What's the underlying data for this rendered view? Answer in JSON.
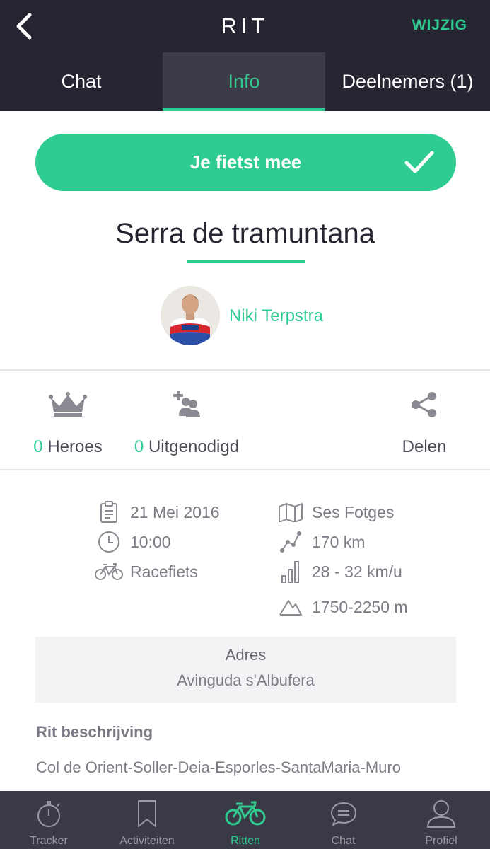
{
  "header": {
    "title": "RIT",
    "edit_label": "WIJZIG"
  },
  "tabs": [
    {
      "label": "Chat"
    },
    {
      "label": "Info",
      "active": true
    },
    {
      "label": "Deelnemers (1)"
    }
  ],
  "join_button": {
    "label": "Je fietst mee"
  },
  "ride": {
    "title": "Serra de tramuntana",
    "host": "Niki Terpstra"
  },
  "stats": {
    "heroes_count": "0",
    "heroes_label": "Heroes",
    "invited_count": "0",
    "invited_label": "Uitgenodigd",
    "share_label": "Delen"
  },
  "details": {
    "date": "21 Mei 2016",
    "time": "10:00",
    "bike_type": "Racefiets",
    "location": "Ses Fotges",
    "distance": "170 km",
    "speed": "28 - 32 km/u",
    "elevation": "1750-2250 m"
  },
  "address": {
    "label": "Adres",
    "value": "Avinguda s'Albufera"
  },
  "description": {
    "label": "Rit beschrijving",
    "text": "Col de Orient-Soller-Deia-Esporles-SantaMaria-Muro"
  },
  "bottom_nav": [
    {
      "label": "Tracker",
      "icon": "stopwatch-icon"
    },
    {
      "label": "Activiteiten",
      "icon": "bookmark-icon"
    },
    {
      "label": "Ritten",
      "icon": "bicycle-icon",
      "active": true
    },
    {
      "label": "Chat",
      "icon": "chat-bubble-icon"
    },
    {
      "label": "Profiel",
      "icon": "person-icon"
    }
  ],
  "colors": {
    "accent": "#2ecc91",
    "header_bg": "#262633",
    "active_tab_bg": "#3c3c48",
    "nav_bg": "#3a3a47"
  }
}
